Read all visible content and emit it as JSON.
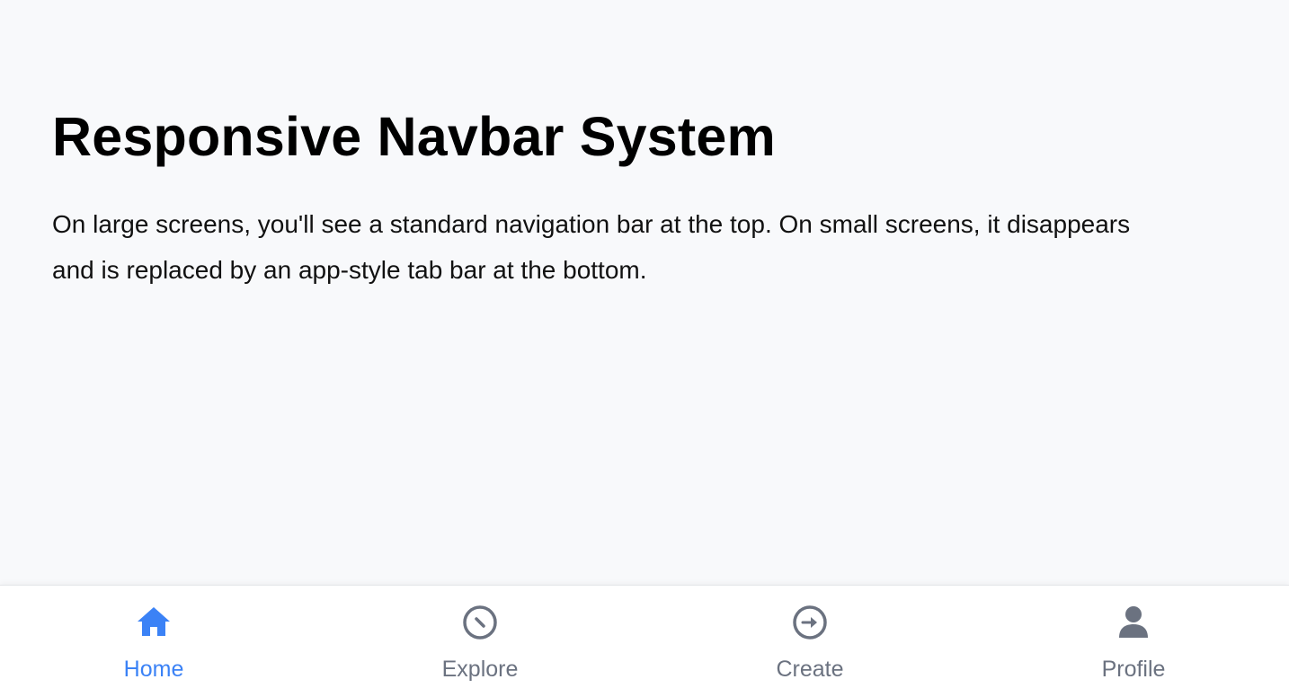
{
  "main": {
    "title": "Responsive Navbar System",
    "description": "On large screens, you'll see a standard navigation bar at the top. On small screens, it disappears and is replaced by an app-style tab bar at the bottom."
  },
  "tabbar": {
    "active": "Home",
    "tabs": [
      {
        "label": "Home",
        "icon": "home-icon"
      },
      {
        "label": "Explore",
        "icon": "compass-icon"
      },
      {
        "label": "Create",
        "icon": "arrow-circle-right-icon"
      },
      {
        "label": "Profile",
        "icon": "user-icon"
      }
    ]
  },
  "colors": {
    "accent": "#3b82f6",
    "inactive": "#6b7280",
    "background": "#f8f9fb",
    "tabbar_background": "#ffffff"
  }
}
